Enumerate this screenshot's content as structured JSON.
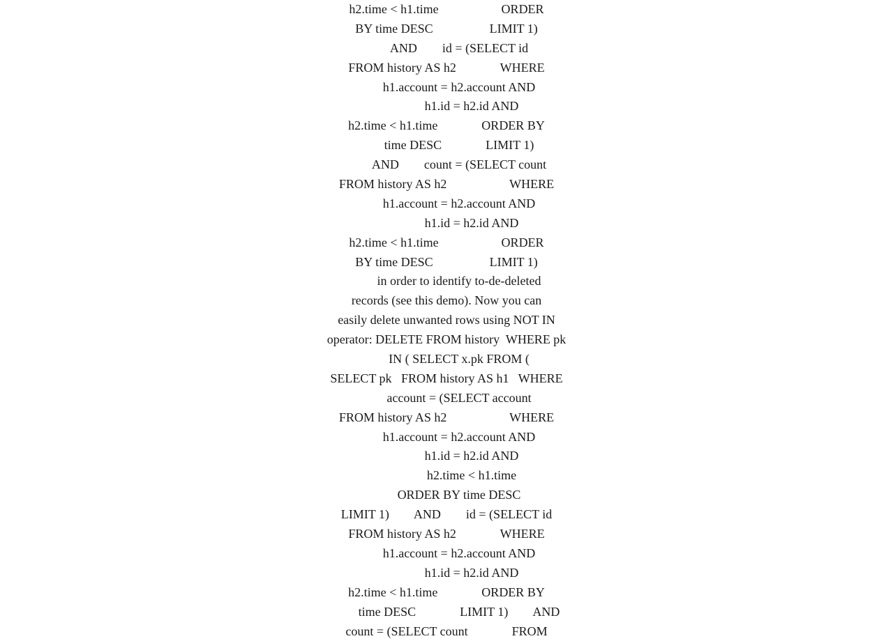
{
  "content": {
    "lines": [
      "h2.time < h1.time                    ORDER",
      "BY time DESC                  LIMIT 1)",
      "        AND        id = (SELECT id",
      "FROM history AS h2              WHERE",
      "        h1.account = h2.account AND",
      "                h1.id = h2.id AND",
      "h2.time < h1.time              ORDER BY",
      "        time DESC              LIMIT 1)",
      "        AND        count = (SELECT count",
      "FROM history AS h2                    WHERE",
      "        h1.account = h2.account AND",
      "                h1.id = h2.id AND",
      "h2.time < h1.time                    ORDER",
      "BY time DESC                  LIMIT 1)",
      "        in order to identify to-de-deleted",
      "records (see this demo). Now you can",
      "easily delete unwanted rows using NOT IN",
      "operator: DELETE FROM history  WHERE pk",
      "        IN ( SELECT x.pk FROM (",
      "SELECT pk   FROM history AS h1   WHERE",
      "        account = (SELECT account",
      "FROM history AS h2                    WHERE",
      "        h1.account = h2.account AND",
      "                h1.id = h2.id AND",
      "                h2.time < h1.time",
      "        ORDER BY time DESC",
      "LIMIT 1)        AND        id = (SELECT id",
      "FROM history AS h2              WHERE",
      "        h1.account = h2.account AND",
      "                h1.id = h2.id AND",
      "h2.time < h1.time              ORDER BY",
      "        time DESC              LIMIT 1)        AND",
      "count = (SELECT count              FROM"
    ]
  }
}
